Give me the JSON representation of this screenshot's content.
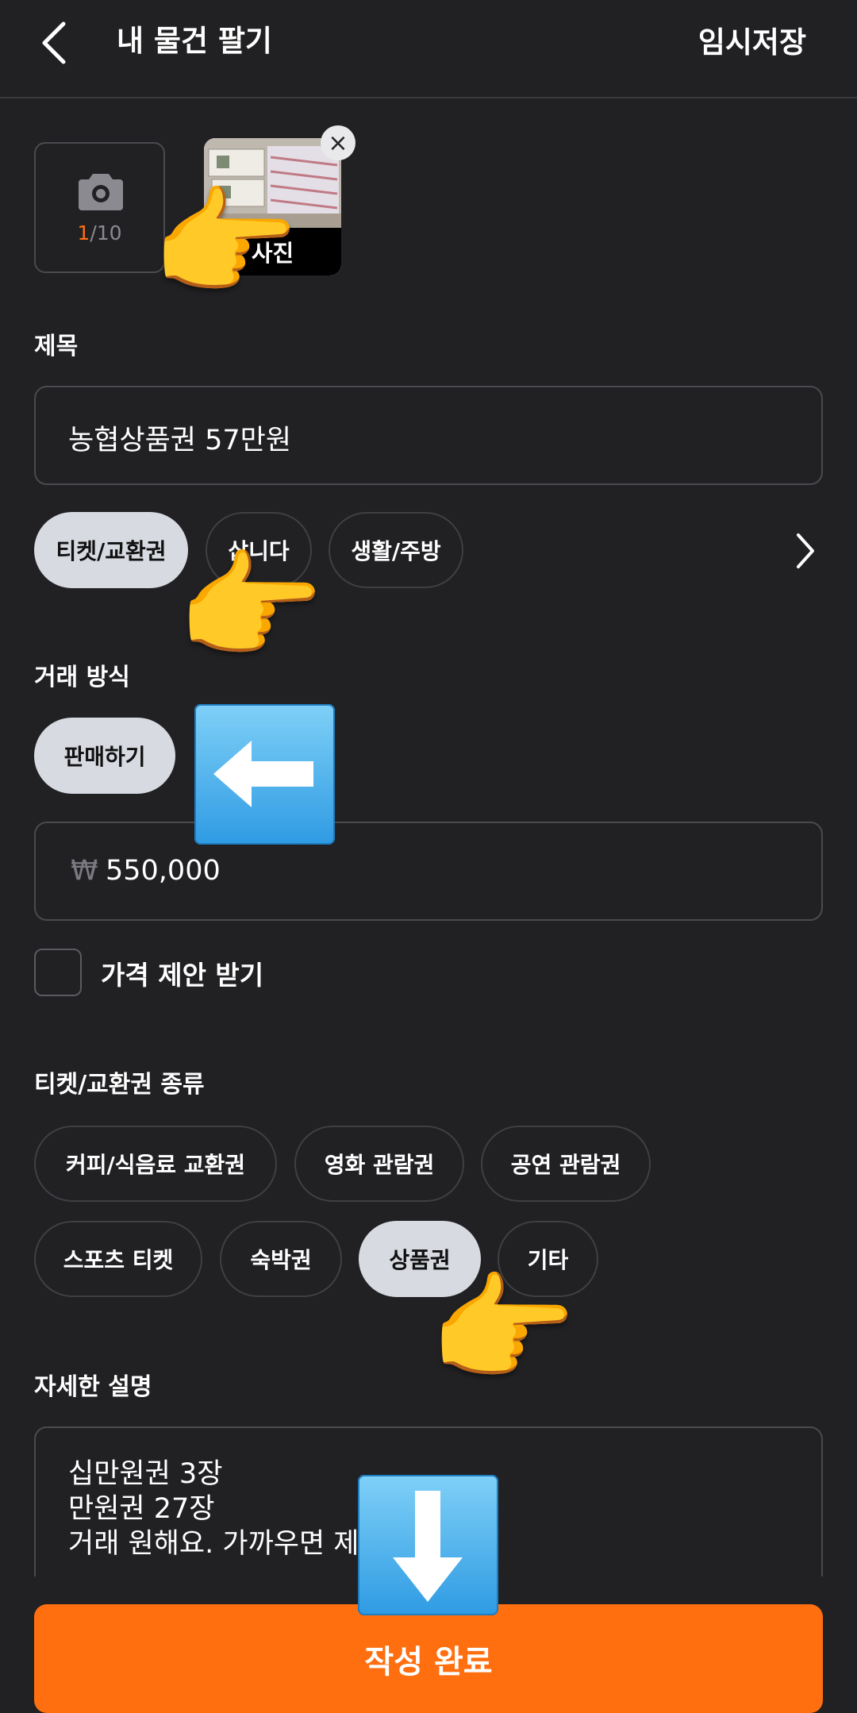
{
  "header": {
    "title": "내 물건 팔기",
    "temp_save": "임시저장"
  },
  "photos": {
    "current": "1",
    "separator_total": "/10",
    "thumb_label": "사진"
  },
  "title_section": {
    "label": "제목",
    "value": "농협상품권 57만원"
  },
  "category_chips": [
    "티켓/교환권",
    "삽니다",
    "생활/주방"
  ],
  "trade": {
    "label": "거래 방식",
    "method": "판매하기",
    "currency_symbol": "₩",
    "price": "550,000",
    "offer_label": "가격 제안 받기"
  },
  "ticket_types": {
    "label": "티켓/교환권 종류",
    "row1": [
      "커피/식음료 교환권",
      "영화 관람권",
      "공연 관람권"
    ],
    "row2": [
      "스포츠 티켓",
      "숙박권",
      "상품권",
      "기타"
    ]
  },
  "description": {
    "label": "자세한 설명",
    "line1": "십만원권 3장",
    "line2": "만원권 27장",
    "line3": "거래 원해요. 가까우면 제가"
  },
  "submit_label": "작성 완료",
  "icons": {
    "back": "chevron-left-icon",
    "camera": "camera-icon",
    "close": "close-icon",
    "more": "chevron-right-icon"
  },
  "colors": {
    "accent": "#ff6f0f",
    "background": "#212124",
    "chip_selected": "#d8dae2"
  }
}
